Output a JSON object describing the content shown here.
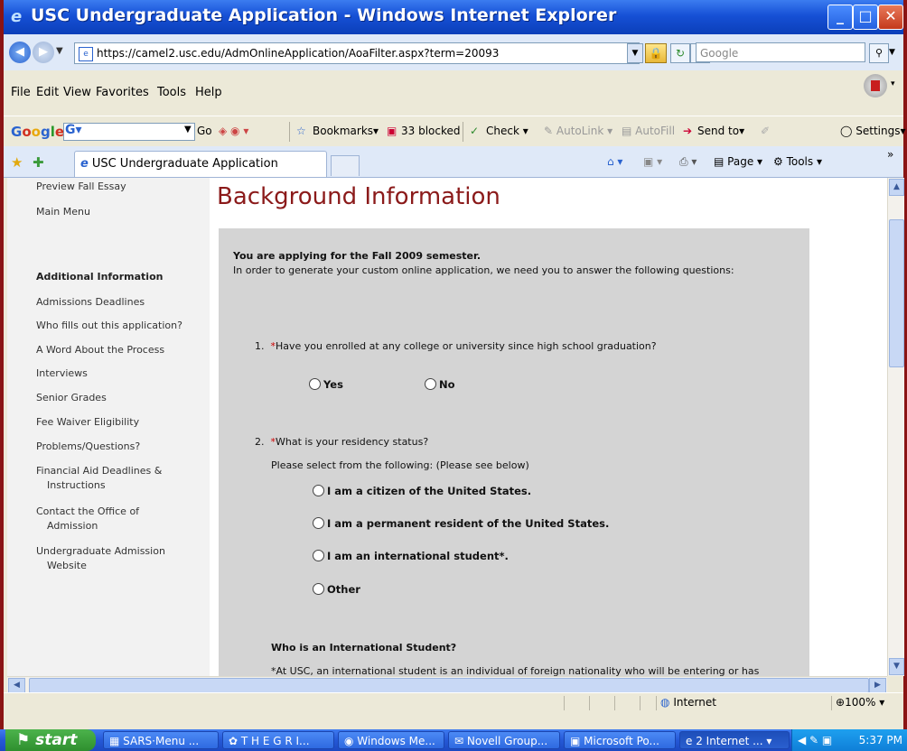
{
  "window": {
    "title": "USC Undergraduate Application - Windows Internet Explorer"
  },
  "address": {
    "url": "https://camel2.usc.edu/AdmOnlineApplication/AoaFilter.aspx?term=20093",
    "search_placeholder": "Google"
  },
  "menu": [
    "File",
    "Edit",
    "View",
    "Favorites",
    "Tools",
    "Help"
  ],
  "google_toolbar": {
    "logo": "Google",
    "go": "Go",
    "bookmarks": "Bookmarks",
    "blocked": "33 blocked",
    "check": "Check",
    "autolink": "AutoLink",
    "autofill": "AutoFill",
    "send_to": "Send to",
    "settings": "Settings"
  },
  "tabs": {
    "active_title": "USC Undergraduate Application",
    "page": "Page",
    "tools": "Tools"
  },
  "sidebar": {
    "top_links": [
      "Preview Fall Essay",
      "Main Menu"
    ],
    "section_title": "Additional Information",
    "links": [
      "Admissions Deadlines",
      "Who fills out this application?",
      "A Word About the Process",
      "Interviews",
      "Senior Grades",
      "Fee Waiver Eligibility",
      "Problems/Questions?"
    ],
    "financial_aid": [
      "Financial Aid Deadlines &",
      "Instructions"
    ],
    "contact": [
      "Contact the Office of",
      "Admission"
    ],
    "website": [
      "Undergraduate Admission",
      "Website"
    ]
  },
  "main": {
    "heading": "Background Information",
    "semester_line": "You are applying for the Fall 2009 semester.",
    "intro_line": "In order to generate your custom online application, we need you to answer the following questions:",
    "q1_number": "1.",
    "q1_text": "Have you enrolled at any college or university since high school graduation?",
    "q1_options": [
      "Yes",
      "No"
    ],
    "q2_number": "2.",
    "q2_text": "What is your residency status?",
    "q2_sub": "Please select from the following: (Please see below)",
    "q2_options": [
      "I am a citizen of the United States.",
      "I am a permanent resident of the United States.",
      "I am an international student*.",
      "Other"
    ],
    "intl_heading": "Who is an International Student?",
    "intl_text": "*At USC, an international student is an individual of foreign nationality who will be entering or has"
  },
  "status": {
    "zone": "Internet",
    "zoom": "100%"
  },
  "taskbar": {
    "start": "start",
    "items": [
      "SARS·Menu ...",
      "T H E G R I...",
      "Windows Me...",
      "Novell Group...",
      "Microsoft Po...",
      "2 Internet ..."
    ],
    "clock": "5:37 PM"
  }
}
